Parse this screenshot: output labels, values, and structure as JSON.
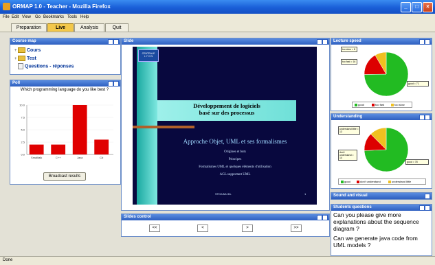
{
  "window": {
    "title": "ORMAP 1.0 - Teacher - Mozilla Firefox",
    "min": "_",
    "max": "□",
    "close": "×"
  },
  "menu": [
    "File",
    "Edit",
    "View",
    "Go",
    "Bookmarks",
    "Tools",
    "Help"
  ],
  "tabs": [
    "Preparation",
    "Live",
    "Analysis",
    "Quit"
  ],
  "course_map": {
    "title": "Course map",
    "items": [
      "Cours",
      "Test",
      "Questions - réponses"
    ]
  },
  "poll": {
    "title": "Poll",
    "question": "Which programming language do you like best ?",
    "button": "Broadcast results",
    "chart_data": {
      "type": "bar",
      "categories": [
        "Smalltalk",
        "C++",
        "Java",
        "C#"
      ],
      "values": [
        2,
        2,
        10,
        3
      ],
      "ylim": [
        0,
        10
      ],
      "yticks": [
        "10.0",
        "7.5",
        "5.0",
        "2.5",
        "0.0"
      ]
    }
  },
  "slide": {
    "title": "Slide",
    "logo1": "CENTRALE",
    "logo2": "L Y O N",
    "heading1": "Développement de logiciels",
    "heading2": "basé sur des processus",
    "subtitle": "Approche Objet, UML et ses formalismes",
    "bullets": [
      "Origines et buts",
      "Principes",
      "Formalismes UML et quelques éléments d'utilisation",
      "AGL supportant UML"
    ],
    "footer_left": "STD/UML/DL",
    "footer_right": "1"
  },
  "slides_control": {
    "title": "Slides control",
    "buttons": [
      "<<",
      "<",
      ">",
      ">>"
    ]
  },
  "lecture_speed": {
    "title": "Lecture speed",
    "legend": [
      "good",
      "too fast",
      "too slow"
    ],
    "callouts": [
      "too slow = 8",
      "too fast = 16",
      "good = 71"
    ],
    "chart_data": {
      "type": "pie",
      "labels": [
        "good",
        "too fast",
        "too slow"
      ],
      "values": [
        71,
        16,
        8
      ],
      "colors": [
        "#22bb22",
        "#dd0000",
        "#f0c020"
      ]
    }
  },
  "understanding": {
    "title": "Understanding",
    "legend": [
      "good",
      "don't understand",
      "understand little"
    ],
    "callouts": [
      "understand little = 13",
      "don't understand = 14",
      "good = 78"
    ],
    "chart_data": {
      "type": "pie",
      "labels": [
        "good",
        "don't understand",
        "understand little"
      ],
      "values": [
        78,
        14,
        13
      ],
      "colors": [
        "#22bb22",
        "#dd0000",
        "#f0c020"
      ]
    }
  },
  "sound": {
    "title": "Sound and visual"
  },
  "questions": {
    "title": "Students questions",
    "items": [
      "Can you please give more explanations about the sequence diagram ?",
      "Can we generate java code from UML models ?"
    ]
  },
  "status": "Done"
}
